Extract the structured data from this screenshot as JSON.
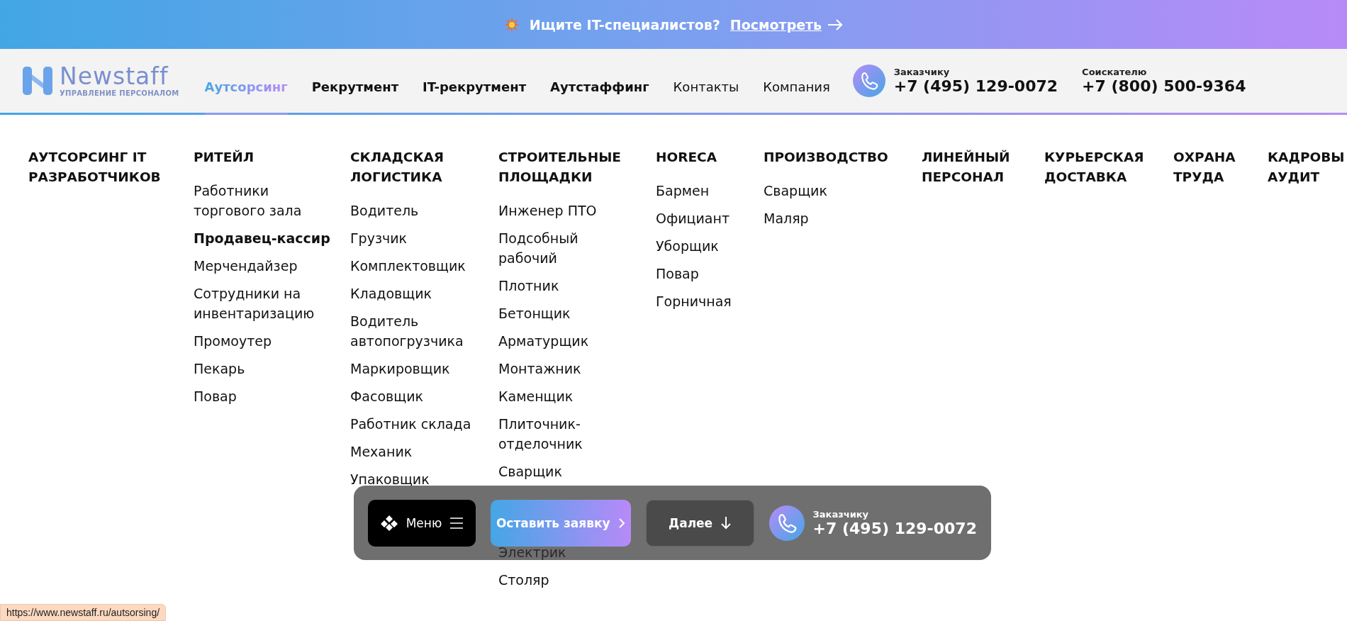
{
  "banner": {
    "text": "Ищите IT-специалистов?",
    "link": "Посмотреть"
  },
  "header": {
    "logo": {
      "name": "Newstaff",
      "tagline": "УПРАВЛЕНИЕ ПЕРСОНАЛОМ"
    },
    "nav": [
      {
        "label": "Аутсорсинг",
        "kind": "primary",
        "selected": true
      },
      {
        "label": "Рекрутмент",
        "kind": "primary",
        "selected": false
      },
      {
        "label": "IT-рекрутмент",
        "kind": "primary",
        "selected": false
      },
      {
        "label": "Аутстаффинг",
        "kind": "primary",
        "selected": false
      },
      {
        "label": "Контакты",
        "kind": "secondary",
        "selected": false
      },
      {
        "label": "Компания",
        "kind": "secondary",
        "selected": false
      }
    ],
    "phones": [
      {
        "label": "Заказчику",
        "number": "+7 (495) 129-0072",
        "icon": true
      },
      {
        "label": "Соискателю",
        "number": "+7 (800) 500-9364",
        "icon": false
      }
    ]
  },
  "mega_menu": [
    {
      "heading": "АУТСОРСИНГ IT РАЗРАБОТЧИКОВ"
    },
    {
      "heading": "РИТЕЙЛ",
      "items": [
        {
          "label": "Работники торгового зала",
          "hovered": false
        },
        {
          "label": "Продавец-кассир",
          "hovered": true
        },
        {
          "label": "Мерчендайзер",
          "hovered": false
        },
        {
          "label": "Сотрудники на инвентаризацию",
          "hovered": false
        },
        {
          "label": "Промоутер",
          "hovered": false
        },
        {
          "label": "Пекарь",
          "hovered": false
        },
        {
          "label": "Повар",
          "hovered": false
        }
      ]
    },
    {
      "heading": "СКЛАДСКАЯ ЛОГИСТИКА",
      "items": [
        {
          "label": "Водитель",
          "hovered": false
        },
        {
          "label": "Грузчик",
          "hovered": false
        },
        {
          "label": "Комплектовщик",
          "hovered": false
        },
        {
          "label": "Кладовщик",
          "hovered": false
        },
        {
          "label": "Водитель автопогрузчика",
          "hovered": false
        },
        {
          "label": "Маркировщик",
          "hovered": false
        },
        {
          "label": "Фасовщик",
          "hovered": false
        },
        {
          "label": "Работник склада",
          "hovered": false
        },
        {
          "label": "Механик",
          "hovered": false
        },
        {
          "label": "Упаковщик",
          "hovered": false
        }
      ]
    },
    {
      "heading": "СТРОИТЕЛЬНЫЕ ПЛОЩАДКИ",
      "items": [
        {
          "label": "Инженер ПТО",
          "hovered": false
        },
        {
          "label": "Подсобный рабочий",
          "hovered": false
        },
        {
          "label": "Плотник",
          "hovered": false
        },
        {
          "label": "Бетонщик",
          "hovered": false
        },
        {
          "label": "Арматурщик",
          "hovered": false
        },
        {
          "label": "Монтажник",
          "hovered": false
        },
        {
          "label": "Каменщик",
          "hovered": false
        },
        {
          "label": "Плиточник-отделочник",
          "hovered": false
        },
        {
          "label": "Сварщик",
          "hovered": false
        },
        {
          "label": "Электрик",
          "hovered": false
        },
        {
          "label": "Столяр",
          "hovered": false
        }
      ]
    },
    {
      "heading": "HORECA",
      "items": [
        {
          "label": "Бармен",
          "hovered": false
        },
        {
          "label": "Официант",
          "hovered": false
        },
        {
          "label": "Уборщик",
          "hovered": false
        },
        {
          "label": "Повар",
          "hovered": false
        },
        {
          "label": "Горничная",
          "hovered": false
        }
      ]
    },
    {
      "heading": "ПРОИЗВОДСТВО",
      "items": [
        {
          "label": "Сварщик",
          "hovered": false
        },
        {
          "label": "Маляр",
          "hovered": false
        }
      ]
    },
    {
      "heading": "ЛИНЕЙНЫЙ ПЕРСОНАЛ"
    },
    {
      "heading": "КУРЬЕРСКАЯ ДОСТАВКА"
    },
    {
      "heading": "ОХРАНА ТРУДА"
    },
    {
      "heading": "КАДРОВЫ АУДИТ"
    }
  ],
  "floating_bar": {
    "menu": "Меню",
    "request": "Оставить заявку",
    "next": "Далее",
    "phone_label": "Заказчику",
    "phone": "+7 (495) 129-0072"
  },
  "status_url": "https://www.newstaff.ru/autsorsing/"
}
